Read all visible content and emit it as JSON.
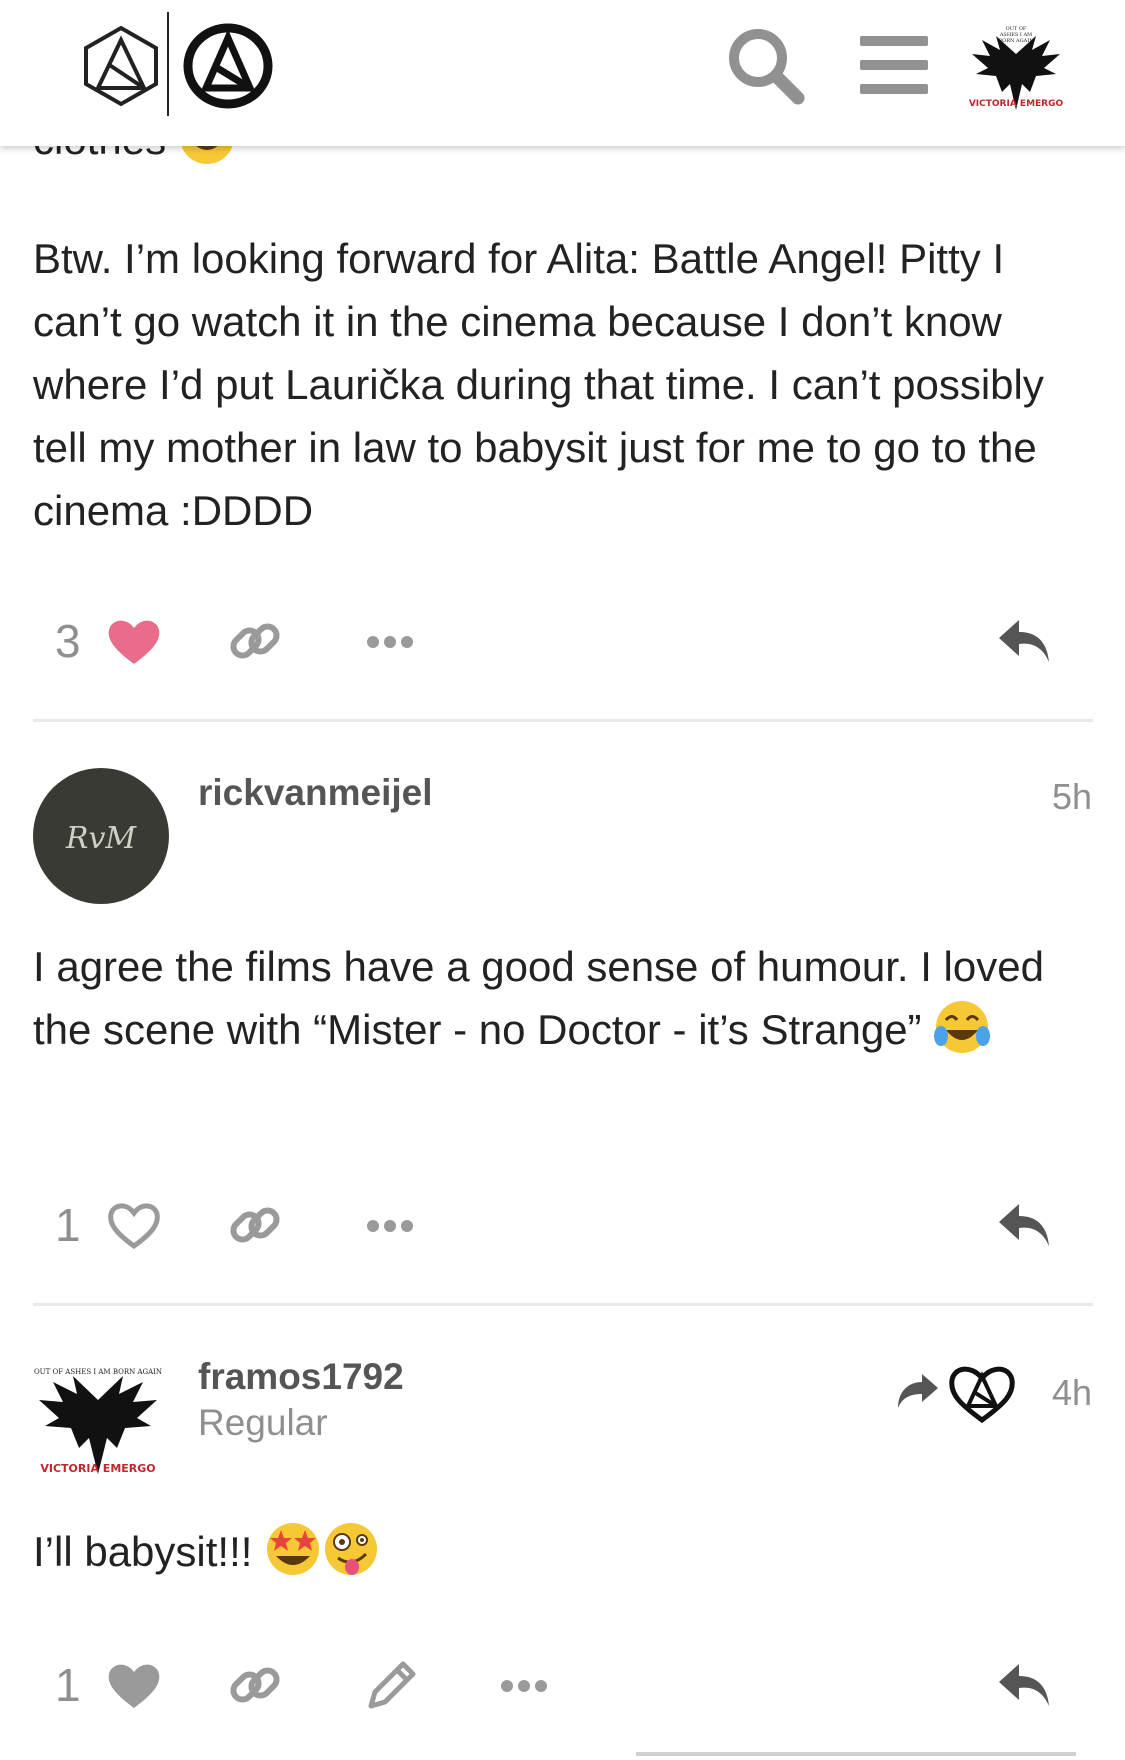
{
  "header": {
    "logo_icons": [
      "linkin-park-hybrid-theory-logo",
      "linkin-park-circle-logo"
    ],
    "search_icon": "search-icon",
    "menu_icon": "hamburger-menu-icon"
  },
  "colors": {
    "like_pink": "#e96d8a",
    "icon_gray": "#9a9a9a",
    "text": "#222222",
    "muted": "#8f8f8f"
  },
  "post_top": {
    "fragment": "clothes",
    "body": "Btw. I’m looking forward for Alita: Battle Angel! Pitty I can’t go watch it in the cinema because I don’t know where I’d put Laurička during that time. I can’t possibly tell my mother in law to babysit just for me to go to the cinema :DDDD",
    "likes": "3"
  },
  "post_rick": {
    "avatar_text": "RvM",
    "username": "rickvanmeijel",
    "time": "5h",
    "body": "I agree the films have a good sense of humour. I loved the scene with “Mister - no Doctor - it’s Strange”",
    "likes": "1"
  },
  "post_framos": {
    "username": "framos1792",
    "title": "Regular",
    "time": "4h",
    "body": "I’ll babysit!!!",
    "likes": "1",
    "avatar_top_text": "OUT OF ASHES I AM BORN AGAIN",
    "avatar_bottom_text": "VICTORIA EMERGO"
  }
}
